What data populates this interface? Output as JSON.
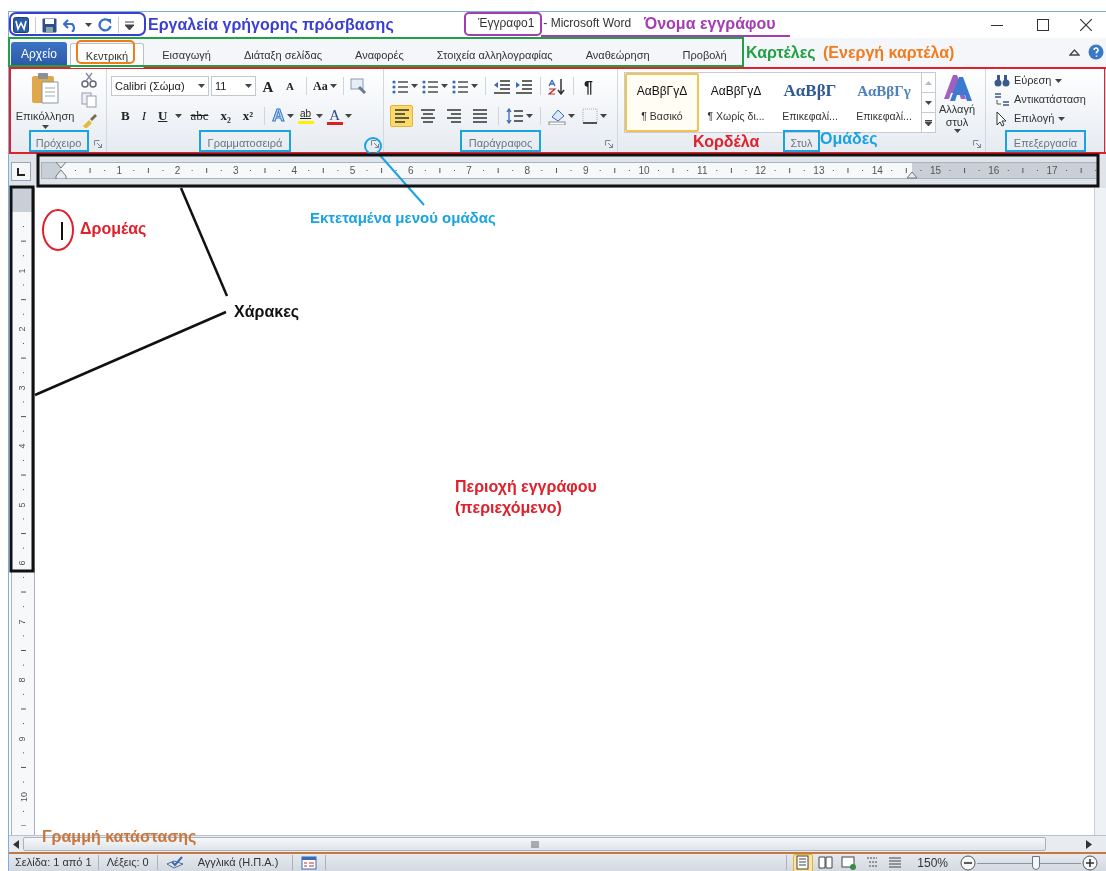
{
  "window": {
    "document_name": "Έγγραφο1",
    "app_name": "- Microsoft Word"
  },
  "tabs": [
    {
      "label": "Αρχείο",
      "kind": "file",
      "selected": false
    },
    {
      "label": "Κεντρική",
      "kind": "tab",
      "selected": true
    },
    {
      "label": "Εισαγωγή",
      "kind": "tab",
      "selected": false
    },
    {
      "label": "Διάταξη σελίδας",
      "kind": "tab",
      "selected": false
    },
    {
      "label": "Αναφορές",
      "kind": "tab",
      "selected": false
    },
    {
      "label": "Στοιχεία αλληλογραφίας",
      "kind": "tab",
      "selected": false
    },
    {
      "label": "Αναθεώρηση",
      "kind": "tab",
      "selected": false
    },
    {
      "label": "Προβολή",
      "kind": "tab",
      "selected": false
    }
  ],
  "ribbon": {
    "clipboard": {
      "paste": "Επικόλληση",
      "label": "Πρόχειρο"
    },
    "font": {
      "font_name": "Calibri (Σώμα)",
      "font_size": "11",
      "grow": "A",
      "shrink": "A",
      "change_case": "Aa",
      "highlight": "ab",
      "text_effects": "A",
      "font_color": "A",
      "format_buttons": [
        {
          "text": "B",
          "kind": "bold"
        },
        {
          "text": "I",
          "kind": "italic"
        },
        {
          "text": "U",
          "kind": "underline"
        },
        {
          "text": "abc",
          "kind": "strike"
        },
        {
          "text": "x₂",
          "kind": "sub"
        },
        {
          "text": "x²",
          "kind": "sup"
        }
      ],
      "label": "Γραμματοσειρά"
    },
    "paragraph": {
      "show_marks": "¶",
      "alignment": [
        {
          "kind": "left",
          "selected": true
        },
        {
          "kind": "center",
          "selected": false
        },
        {
          "kind": "right",
          "selected": false
        },
        {
          "kind": "justify",
          "selected": false
        }
      ],
      "label": "Παράγραφος"
    },
    "styles": {
      "items": [
        {
          "preview": "ΑαΒβΓγΔ",
          "name": "¶ Βασικό",
          "kind": "body",
          "selected": true
        },
        {
          "preview": "ΑαΒβΓγΔ",
          "name": "¶ Χωρίς δι...",
          "kind": "body",
          "selected": false
        },
        {
          "preview": "ΑαΒβΓ",
          "name": "Επικεφαλί...",
          "kind": "heading1",
          "selected": false
        },
        {
          "preview": "ΑαΒβΓγ",
          "name": "Επικεφαλί...",
          "kind": "heading2",
          "selected": false
        }
      ],
      "change_styles": "Αλλαγή στυλ",
      "label": "Στυλ"
    },
    "editing": {
      "items": [
        {
          "label": "Εύρεση",
          "kind": "find"
        },
        {
          "label": "Αντικατάσταση",
          "kind": "replace"
        },
        {
          "label": "Επιλογή",
          "kind": "select"
        }
      ],
      "label": "Επεξεργασία"
    }
  },
  "ruler": {
    "horizontal": [
      "1",
      "2",
      "3",
      "4",
      "5",
      "6",
      "7",
      "8",
      "9",
      "10",
      "11",
      "12",
      "13",
      "14",
      "15",
      "16",
      "17"
    ],
    "vertical": [
      "1",
      "2",
      "3",
      "4",
      "5",
      "6",
      "7",
      "8",
      "9",
      "10"
    ]
  },
  "status_bar": {
    "page": "Σελίδα: 1 από 1",
    "words": "Λέξεις: 0",
    "language": "Αγγλικά (Η.Π.Α.)",
    "views": [
      {
        "kind": "print",
        "selected": true
      },
      {
        "kind": "reading",
        "selected": false
      },
      {
        "kind": "web",
        "selected": false
      },
      {
        "kind": "outline",
        "selected": false
      },
      {
        "kind": "draft",
        "selected": false
      }
    ],
    "zoom": "150%",
    "zoom_slider": {
      "level": 0.57
    }
  },
  "annotations": [
    {
      "kind": "quick_access",
      "text": "Εργαλεία γρήγορης πρόσβασης",
      "color": "#3b3fd0"
    },
    {
      "kind": "doc_name",
      "text": "Όνομα εγγράφου",
      "color": "#a43cb4"
    },
    {
      "kind": "tabs",
      "text": "Καρτέλες",
      "color": "#22a045"
    },
    {
      "kind": "active_tab",
      "text": "(Ενεργή καρτέλα)",
      "color": "#f07c1e"
    },
    {
      "kind": "ribbon",
      "text": "Κορδέλα",
      "color": "#e0202a"
    },
    {
      "kind": "groups",
      "text": "Ομάδες",
      "color": "#1aa3e2"
    },
    {
      "kind": "launcher",
      "text": "Εκτεταμένα μενού ομάδας",
      "color": "#1aa3e2"
    },
    {
      "kind": "cursor",
      "text": "Δρομέας",
      "color": "#e0202a"
    },
    {
      "kind": "rulers",
      "text": "Χάρακες",
      "color": "#111111"
    },
    {
      "kind": "document",
      "text": "Περιοχή εγγράφου (περιεχόμενο)",
      "color": "#e0202a"
    },
    {
      "kind": "status",
      "text": "Γραμμή κατάστασης",
      "color": "#c8773f"
    }
  ]
}
